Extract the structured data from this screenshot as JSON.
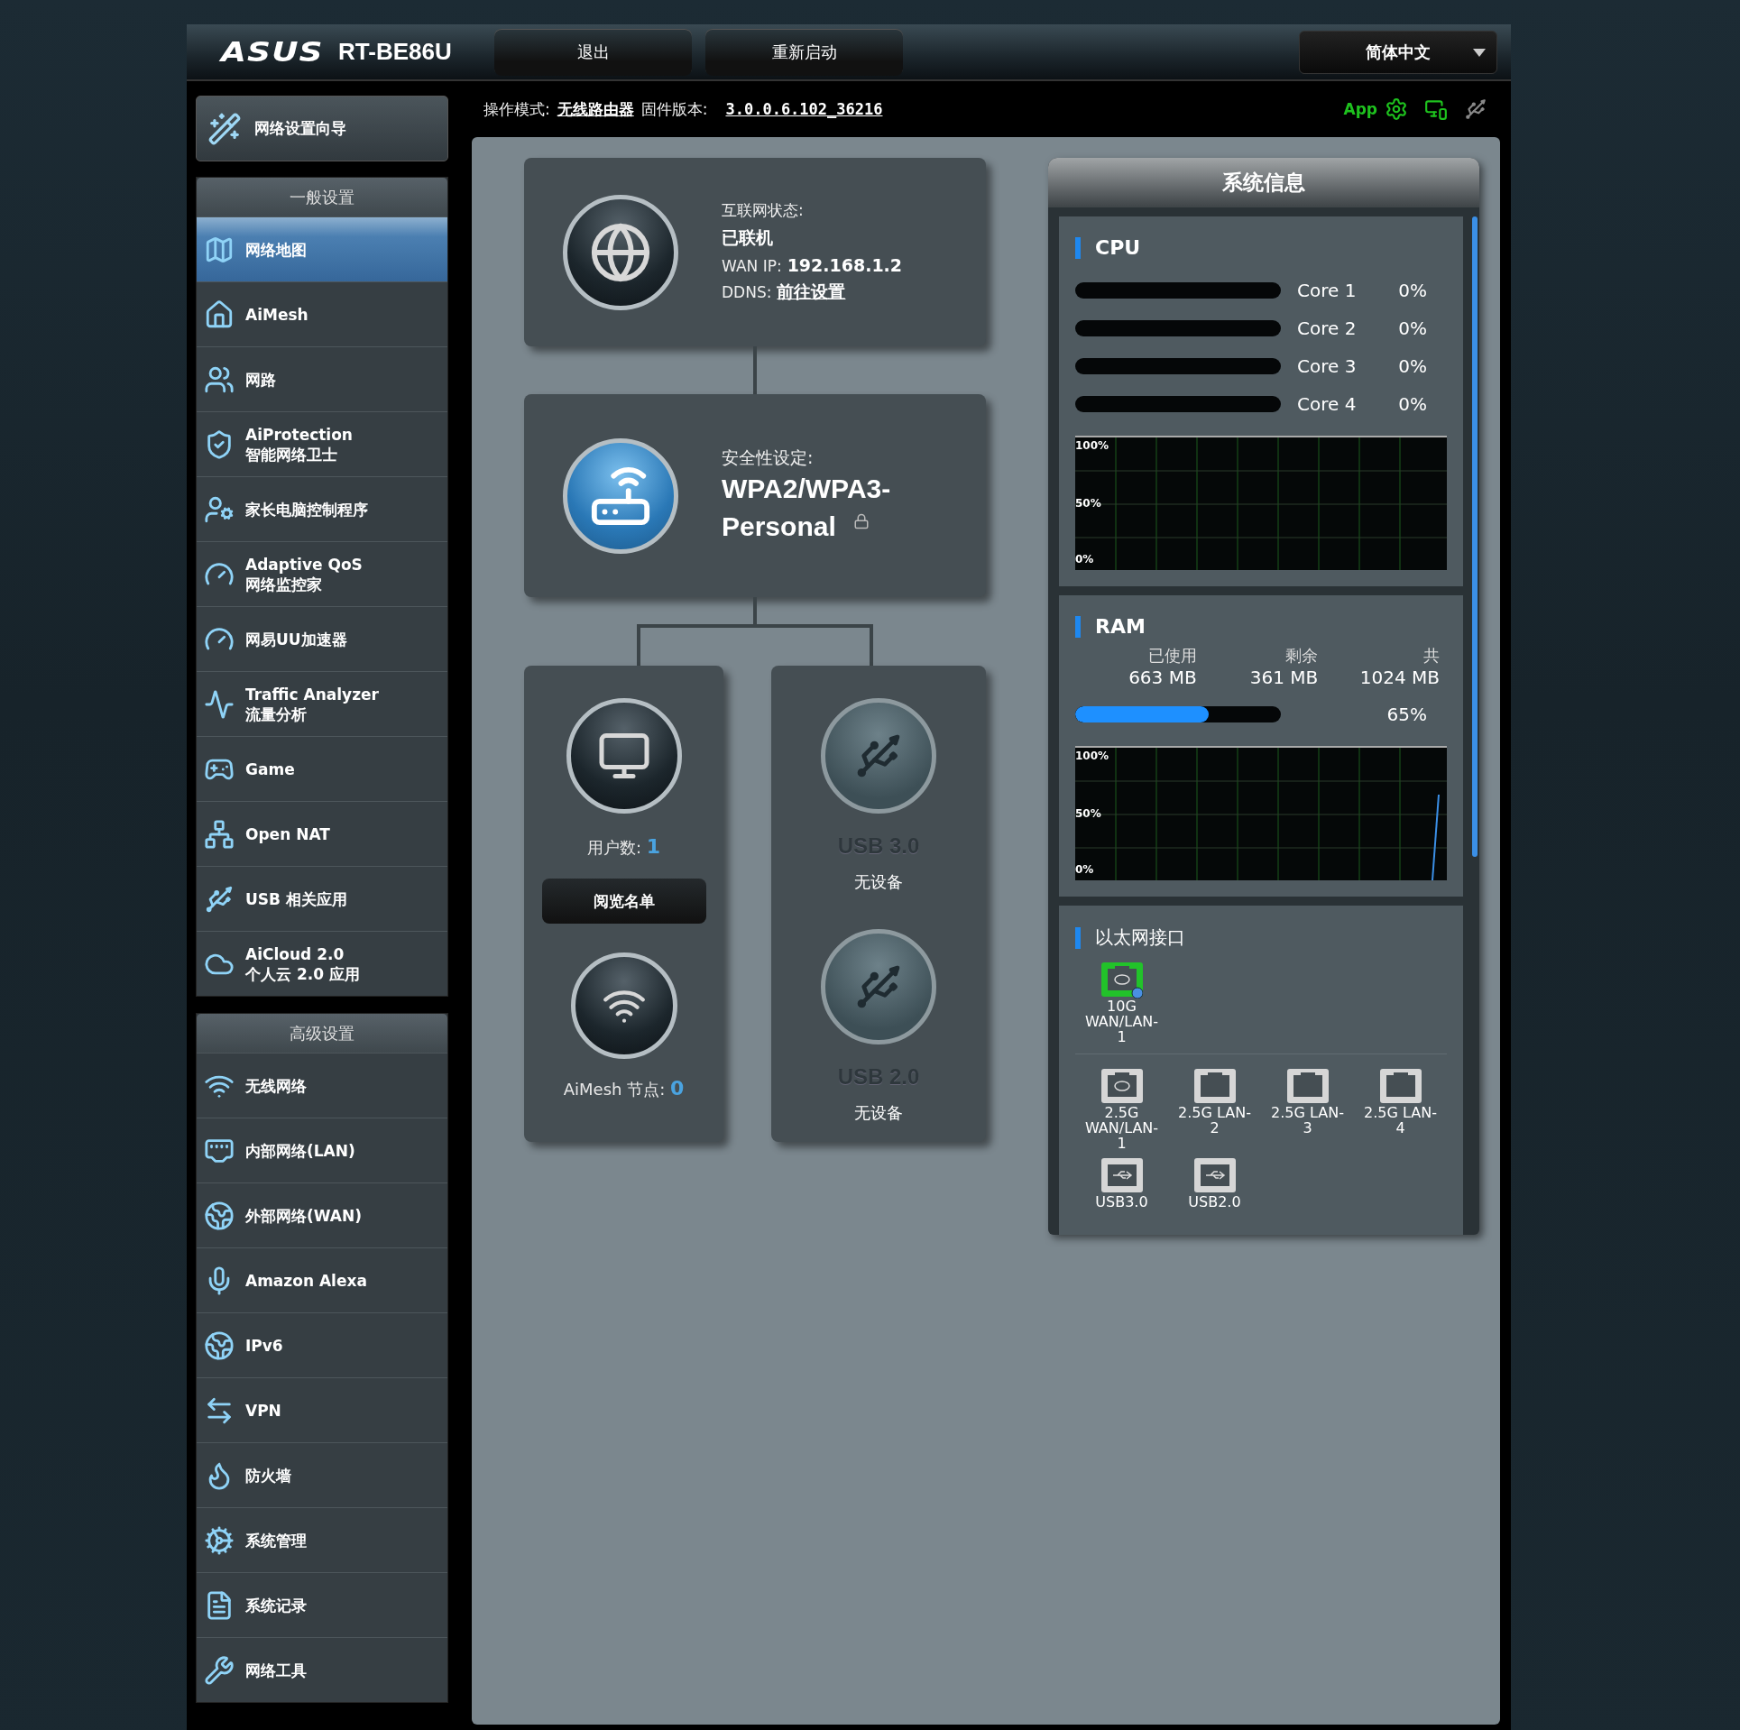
{
  "header": {
    "logo": "ASUS",
    "model": "RT-BE86U",
    "buttons": [
      "退出",
      "重新启动"
    ],
    "language": "简体中文"
  },
  "status_line": {
    "mode_label": "操作模式:",
    "mode_value": "无线路由器",
    "firmware_label": "固件版本:",
    "firmware_value": "3.0.0.6.102_36216",
    "app_label": "App"
  },
  "sidebar": {
    "wizard": "网络设置向导",
    "sections": [
      {
        "title": "一般设置",
        "items": [
          {
            "lines": [
              "网络地图"
            ],
            "selected": true
          },
          {
            "lines": [
              "AiMesh"
            ],
            "selected": false
          },
          {
            "lines": [
              "网路"
            ],
            "selected": false
          },
          {
            "lines": [
              "AiProtection",
              "智能网络卫士"
            ],
            "selected": false
          },
          {
            "lines": [
              "家长电脑控制程序"
            ],
            "selected": false
          },
          {
            "lines": [
              "Adaptive QoS",
              "网络监控家"
            ],
            "selected": false
          },
          {
            "lines": [
              "网易UU加速器"
            ],
            "selected": false
          },
          {
            "lines": [
              "Traffic Analyzer",
              "流量分析"
            ],
            "selected": false
          },
          {
            "lines": [
              "Game"
            ],
            "selected": false
          },
          {
            "lines": [
              "Open NAT"
            ],
            "selected": false
          },
          {
            "lines": [
              "USB 相关应用"
            ],
            "selected": false
          },
          {
            "lines": [
              "AiCloud 2.0",
              "个人云 2.0 应用"
            ],
            "selected": false
          }
        ]
      },
      {
        "title": "高级设置",
        "items": [
          {
            "lines": [
              "无线网络"
            ],
            "selected": false
          },
          {
            "lines": [
              "内部网络(LAN)"
            ],
            "selected": false
          },
          {
            "lines": [
              "外部网络(WAN)"
            ],
            "selected": false
          },
          {
            "lines": [
              "Amazon Alexa"
            ],
            "selected": false
          },
          {
            "lines": [
              "IPv6"
            ],
            "selected": false
          },
          {
            "lines": [
              "VPN"
            ],
            "selected": false
          },
          {
            "lines": [
              "防火墙"
            ],
            "selected": false
          },
          {
            "lines": [
              "系统管理"
            ],
            "selected": false
          },
          {
            "lines": [
              "系统记录"
            ],
            "selected": false
          },
          {
            "lines": [
              "网络工具"
            ],
            "selected": false
          }
        ]
      }
    ]
  },
  "internet": {
    "label": "互联网状态:",
    "status": "已联机",
    "wan_ip_label": "WAN IP:",
    "wan_ip": "192.168.1.2",
    "ddns_label": "DDNS:",
    "ddns_link": "前往设置"
  },
  "security": {
    "label": "安全性设定:",
    "value": "WPA2/WPA3-Personal",
    "locked": true
  },
  "clients": {
    "label": "用户数:",
    "count": "1",
    "button": "阅览名单",
    "aimesh_label": "AiMesh 节点:",
    "aimesh_count": "0"
  },
  "usb": [
    {
      "name": "USB 3.0",
      "status": "无设备"
    },
    {
      "name": "USB 2.0",
      "status": "无设备"
    }
  ],
  "system_info": {
    "title": "系统信息",
    "cpu": {
      "title": "CPU",
      "cores": [
        {
          "name": "Core 1",
          "reading": "0%"
        },
        {
          "name": "Core 2",
          "reading": "0%"
        },
        {
          "name": "Core 3",
          "reading": "0%"
        },
        {
          "name": "Core 4",
          "reading": "0%"
        }
      ],
      "graph_labels": [
        "100%",
        "50%",
        "0%"
      ]
    },
    "ram": {
      "title": "RAM",
      "stats": [
        {
          "label": "已使用",
          "value": "663 MB"
        },
        {
          "label": "剩余",
          "value": "361 MB"
        },
        {
          "label": "共",
          "value": "1024 MB"
        }
      ],
      "level": 0.65,
      "reading": "65%",
      "graph_labels": [
        "100%",
        "50%",
        "0%"
      ]
    },
    "ethernet": {
      "title": "以太网接口",
      "wan_ports": [
        {
          "label": "10G WAN/LAN-1",
          "kind": "wan",
          "connected": true
        }
      ],
      "ports": [
        {
          "label": "2.5G WAN/LAN-1",
          "kind": "wan",
          "connected": false
        },
        {
          "label": "2.5G LAN-2",
          "kind": "lan",
          "connected": false
        },
        {
          "label": "2.5G LAN-3",
          "kind": "lan",
          "connected": false
        },
        {
          "label": "2.5G LAN-4",
          "kind": "lan",
          "connected": false
        },
        {
          "label": "USB3.0",
          "kind": "usb",
          "connected": false
        },
        {
          "label": "USB2.0",
          "kind": "usb",
          "connected": false
        }
      ]
    }
  }
}
